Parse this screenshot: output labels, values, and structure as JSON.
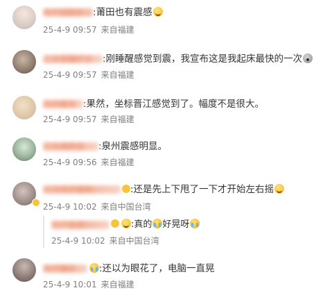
{
  "comments": [
    {
      "name": "用户已隐藏名",
      "text": ":莆田也有震感",
      "time": "25-4-9 09:57",
      "source": "来自福建",
      "emoji": "laugh-tears-emoji"
    },
    {
      "name": "上文字用户名",
      "text": ":刚睡醒感觉到震，我宣布这是我起床最快的一次",
      "time": "25-4-9 09:57",
      "source": "来自福建",
      "emoji": "shocked-emoji"
    },
    {
      "name": "用户名隐",
      "text": ":果然，坐标晋江感觉到了。幅度不是很大。",
      "time": "25-4-9 09:57",
      "source": "来自福建"
    },
    {
      "name": "无名用户音",
      "text": ":泉州震感明显。",
      "time": "25-4-9 09:56",
      "source": "来自福建"
    },
    {
      "name": "台湾用户名称",
      "text": ":还是先上下甩了一下才开始左右摇",
      "time": "25-4-9 10:02",
      "source": "来自中国台湾",
      "emoji": "laugh-tears-emoji",
      "reply": {
        "name": "用户名子",
        "text_a": ":真的",
        "text_b": "好晃呀",
        "time": "25-4-9 10:02",
        "source": "来自中国台湾"
      }
    },
    {
      "name": "用户隐名",
      "text": ":还以为眼花了，电脑一直晃",
      "time": "25-4-9 10:01",
      "source": "来自福建"
    }
  ],
  "colors": {
    "name_blur": "#f1b39a",
    "meta_gray": "#808080",
    "text": "#333333"
  }
}
